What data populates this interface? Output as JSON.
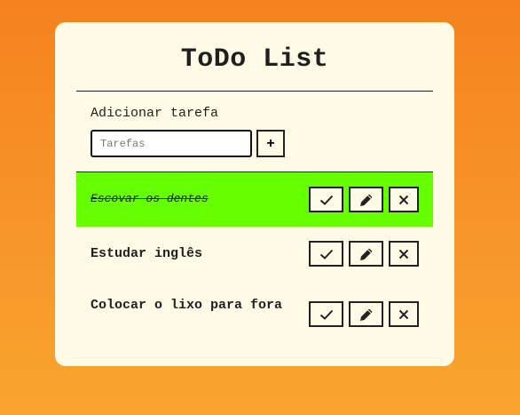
{
  "app": {
    "title": "ToDo List"
  },
  "add_form": {
    "label": "Adicionar tarefa",
    "input_placeholder": "Tarefas",
    "input_value": "",
    "add_button_label": "+"
  },
  "todos": [
    {
      "text": "Escovar os dentes",
      "done": true
    },
    {
      "text": "Estudar inglês",
      "done": false
    },
    {
      "text": "Colocar o lixo para fora",
      "done": false
    }
  ],
  "actions": {
    "finish_icon": "check-icon",
    "edit_icon": "pencil-icon",
    "remove_icon": "x-icon"
  },
  "colors": {
    "background_top": "#f5821e",
    "background_bottom": "#f9a52d",
    "card": "#fffbe6",
    "done_highlight": "#66ff00",
    "text": "#1f1f1f"
  }
}
